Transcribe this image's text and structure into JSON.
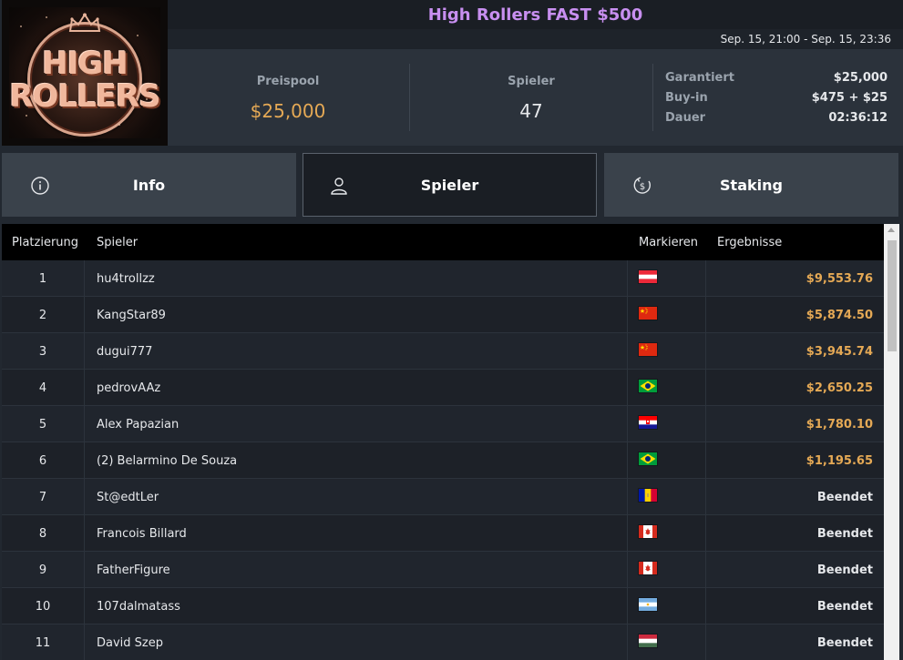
{
  "logo": {
    "line1": "HIGH",
    "line2": "ROLLERS"
  },
  "header": {
    "title": "High Rollers FAST $500",
    "dates": "Sep. 15, 21:00 - Sep. 15, 23:36"
  },
  "stats": {
    "prize_pool_label": "Preispool",
    "prize_pool_value": "$25,000",
    "players_label": "Spieler",
    "players_value": "47",
    "details": [
      {
        "key": "Garantiert",
        "value": "$25,000"
      },
      {
        "key": "Buy-in",
        "value": "$475 + $25"
      },
      {
        "key": "Dauer",
        "value": "02:36:12"
      }
    ]
  },
  "tabs": [
    {
      "label": "Info",
      "icon": "info-icon",
      "active": false
    },
    {
      "label": "Spieler",
      "icon": "user-icon",
      "active": true
    },
    {
      "label": "Staking",
      "icon": "staking-dollar-icon",
      "active": false
    }
  ],
  "table": {
    "headers": {
      "rank": "Platzierung",
      "player": "Spieler",
      "flag": "Markieren",
      "result": "Ergebnisse"
    },
    "rows": [
      {
        "rank": "1",
        "name": "hu4trollzz",
        "flag": "austria",
        "result": "$9,553.76",
        "paid": true
      },
      {
        "rank": "2",
        "name": "KangStar89",
        "flag": "china",
        "result": "$5,874.50",
        "paid": true
      },
      {
        "rank": "3",
        "name": "dugui777",
        "flag": "china",
        "result": "$3,945.74",
        "paid": true
      },
      {
        "rank": "4",
        "name": "pedrovAAz",
        "flag": "brazil",
        "result": "$2,650.25",
        "paid": true
      },
      {
        "rank": "5",
        "name": "Alex Papazian",
        "flag": "croatia",
        "result": "$1,780.10",
        "paid": true
      },
      {
        "rank": "6",
        "name": "(2) Belarmino De Souza",
        "flag": "brazil",
        "result": "$1,195.65",
        "paid": true
      },
      {
        "rank": "7",
        "name": "St@edtLer",
        "flag": "andorra",
        "result": "Beendet",
        "paid": false
      },
      {
        "rank": "8",
        "name": "Francois Billard",
        "flag": "canada",
        "result": "Beendet",
        "paid": false
      },
      {
        "rank": "9",
        "name": "FatherFigure",
        "flag": "canada",
        "result": "Beendet",
        "paid": false
      },
      {
        "rank": "10",
        "name": "107dalmatass",
        "flag": "argentina",
        "result": "Beendet",
        "paid": false
      },
      {
        "rank": "11",
        "name": "David Szep",
        "flag": "hungary",
        "result": "Beendet",
        "paid": false
      }
    ]
  },
  "colors": {
    "accent_title": "#c88ff0",
    "gold": "#e5a955",
    "panel": "#2b323b",
    "tab": "#3a424b"
  }
}
